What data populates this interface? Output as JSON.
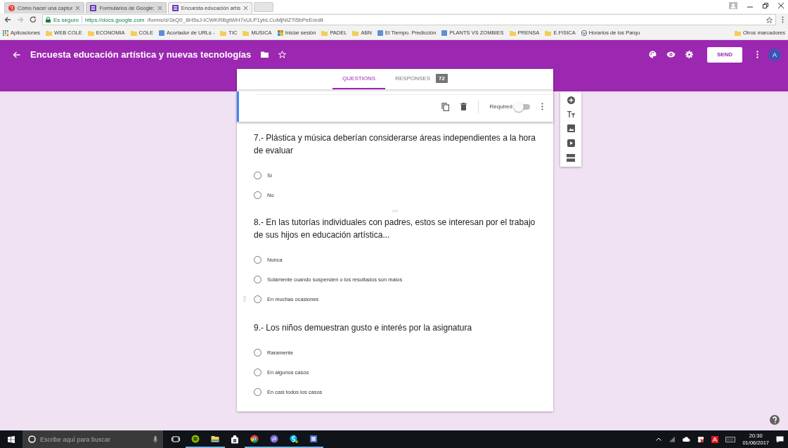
{
  "browser": {
    "tabs": [
      {
        "title": "Cómo hacer una captur",
        "kind": "help",
        "selected": false
      },
      {
        "title": "Formularios de Google:",
        "kind": "forms",
        "selected": false
      },
      {
        "title": "Encuesta educación artís",
        "kind": "forms",
        "selected": true
      }
    ],
    "security": "Es seguro",
    "url_host": "https://docs.google.com",
    "url_path": "/forms/d/1kQ0_8H5sJ-ICWKRBgtWH7xULP1ybLCuMjNIZTi5bPeE/edit",
    "bookmarks": [
      {
        "label": "Aplicaciones",
        "kind": "apps"
      },
      {
        "label": "WEB COLE",
        "kind": "folder"
      },
      {
        "label": "ECONOMIA",
        "kind": "folder"
      },
      {
        "label": "COLE",
        "kind": "folder"
      },
      {
        "label": "Acortador de URLs -",
        "kind": "link"
      },
      {
        "label": "TIC",
        "kind": "folder"
      },
      {
        "label": "MUSICA",
        "kind": "folder"
      },
      {
        "label": "Iniciar sesión",
        "kind": "windows"
      },
      {
        "label": "PADEL",
        "kind": "folder"
      },
      {
        "label": "ABN",
        "kind": "folder"
      },
      {
        "label": "El Tiempo. Predicción",
        "kind": "link"
      },
      {
        "label": "PLANTS VS ZOMBIES",
        "kind": "link"
      },
      {
        "label": "PRENSA",
        "kind": "folder"
      },
      {
        "label": "E.FISICA",
        "kind": "folder"
      },
      {
        "label": "Horarios de los Parqu",
        "kind": "globe"
      }
    ],
    "other_bookmarks": "Otros marcadores"
  },
  "form": {
    "title": "Encuesta educación artística y nuevas tecnologías",
    "send": "SEND",
    "avatar": "A",
    "tabs": [
      {
        "label": "QUESTIONS",
        "selected": true
      },
      {
        "label": "RESPONSES",
        "selected": false,
        "badge": "72"
      }
    ],
    "required_label": "Required",
    "required_on": false,
    "questions": [
      {
        "title": "7.- Plástica y música deberían considerarse áreas independientes a la hora de evaluar",
        "drag_handle": false,
        "options": [
          {
            "label": "Sí",
            "selected": false
          },
          {
            "label": "No",
            "selected": false
          }
        ]
      },
      {
        "title": "8.- En las tutorías individuales con padres, estos se interesan por el trabajo de sus hijos en educación artística...",
        "drag_handle": true,
        "options": [
          {
            "label": "Nunca",
            "selected": false
          },
          {
            "label": "Solamente cuando suspenden o los resultados son malos",
            "selected": false
          },
          {
            "label": "En muchas ocasiones",
            "selected": false
          }
        ]
      },
      {
        "title": "9.- Los niños demuestran gusto e interés por la asignatura",
        "drag_handle": false,
        "options": [
          {
            "label": "Raramente",
            "selected": false
          },
          {
            "label": "En algunos casos",
            "selected": false
          },
          {
            "label": "En casi todos los casos",
            "selected": false
          }
        ]
      }
    ]
  },
  "taskbar": {
    "search_placeholder": "Escribe aquí para buscar",
    "time": "20:30",
    "date": "01/06/2017"
  }
}
